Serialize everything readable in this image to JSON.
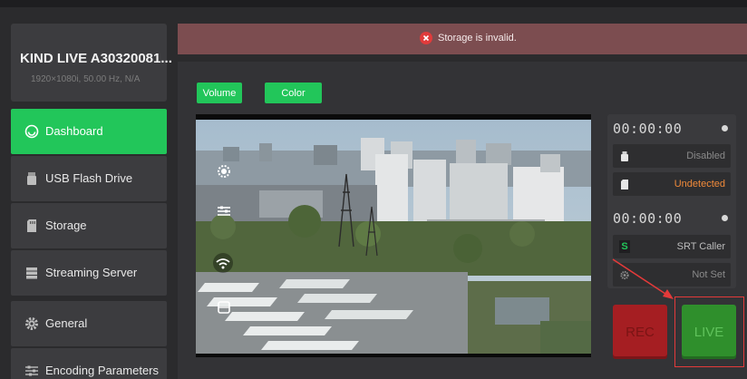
{
  "device": {
    "name": "KIND LIVE A30320081...",
    "info": "1920×1080i, 50.00 Hz, N/A"
  },
  "sidebar": {
    "items": [
      {
        "label": "Dashboard",
        "icon": "dashboard-icon",
        "active": true
      },
      {
        "label": "USB Flash Drive",
        "icon": "usb-drive-icon"
      },
      {
        "label": "Storage",
        "icon": "sd-card-icon"
      },
      {
        "label": "Streaming Server",
        "icon": "server-icon"
      },
      {
        "label": "General",
        "icon": "gear-icon"
      },
      {
        "label": "Encoding Parameters",
        "icon": "sliders-icon"
      }
    ]
  },
  "banner": {
    "message": "Storage is invalid.",
    "icon": "error-circle-icon",
    "color": "#7c4d50"
  },
  "toolbar": {
    "volume_label": "Volume",
    "color_label": "Color"
  },
  "preview": {
    "overlay_icons": [
      "settings-overlay-icon",
      "sliders-overlay-icon",
      "wifi-overlay-icon",
      "storage-overlay-icon"
    ]
  },
  "status": {
    "record": {
      "timer": "00:00:00",
      "drive_status": "Disabled",
      "storage_status": "Undetected"
    },
    "stream": {
      "timer": "00:00:00",
      "protocol_badge": "S",
      "protocol": "SRT Caller",
      "server_status": "Not Set"
    }
  },
  "actions": {
    "rec_label": "REC",
    "live_label": "LIVE"
  },
  "colors": {
    "accent": "#22c65a",
    "rec": "#a51e22",
    "live": "#2f8f2c",
    "warning": "#f08a3a",
    "annotation": "#e43a3a"
  }
}
